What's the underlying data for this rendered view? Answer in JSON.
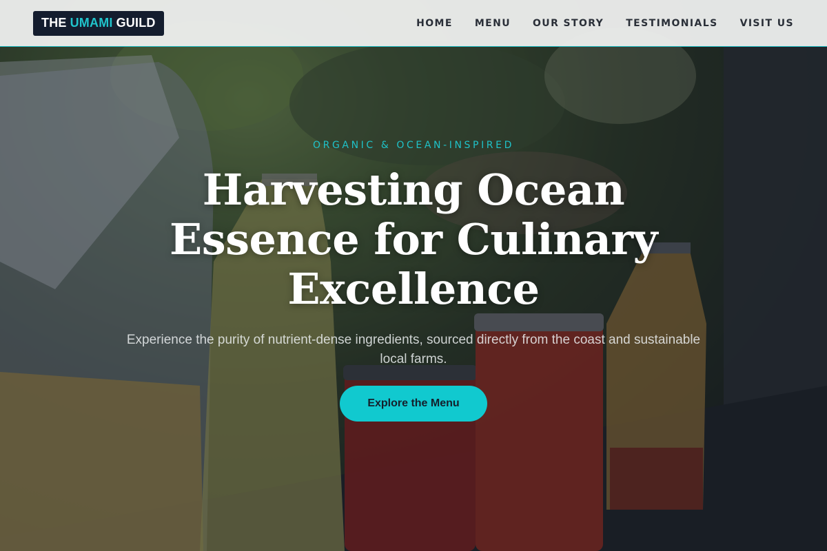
{
  "brand": {
    "name_prefix": "THE",
    "name_accent": "UMAMI",
    "name_suffix": "GUILD",
    "accent_color": "#20c4cc",
    "badge_color": "#141d2e"
  },
  "nav": {
    "items": [
      {
        "label": "HOME"
      },
      {
        "label": "MENU"
      },
      {
        "label": "OUR STORY"
      },
      {
        "label": "TESTIMONIALS"
      },
      {
        "label": "VISIT US"
      }
    ]
  },
  "hero": {
    "eyebrow": "ORGANIC & OCEAN-INSPIRED",
    "headline": "Harvesting Ocean Essence for Culinary Excellence",
    "subtext": "Experience the purity of nutrient-dense ingredients, sourced directly from the coast and sustainable local farms.",
    "cta_label": "Explore the Menu",
    "cta_color": "#11c9cf",
    "background_image": "jars of infused drinks and fermented fruit on a wooden table"
  }
}
